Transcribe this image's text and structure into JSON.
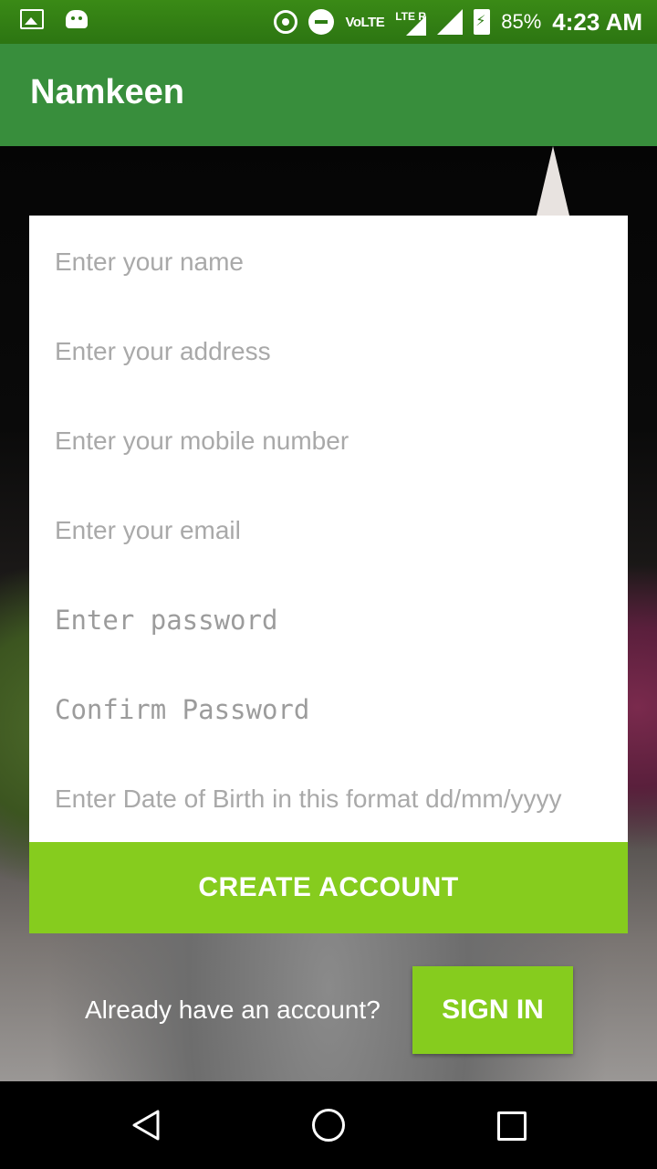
{
  "status_bar": {
    "volte": "VoLTE",
    "lte": "LTE R",
    "battery": "85%",
    "time": "4:23 AM",
    "icons": [
      "image-icon",
      "android-icon",
      "hotspot-icon",
      "do-not-disturb-icon",
      "signal-icon",
      "battery-charging-icon"
    ]
  },
  "app_bar": {
    "title": "Namkeen"
  },
  "form": {
    "name_placeholder": "Enter your name",
    "address_placeholder": "Enter your address",
    "mobile_placeholder": "Enter your mobile number",
    "email_placeholder": "Enter your email",
    "password_placeholder": "Enter password",
    "confirm_password_placeholder": "Confirm Password",
    "dob_placeholder": "Enter Date of Birth in this format dd/mm/yyyy",
    "create_account_label": "CREATE ACCOUNT"
  },
  "footer": {
    "already_text": "Already have an account?",
    "sign_in_label": "SIGN IN"
  },
  "colors": {
    "status_bar": "#2e7d14",
    "app_bar": "#388e3c",
    "accent_button": "#86cc1e"
  },
  "nav_bar": {
    "icons": [
      "back-icon",
      "home-icon",
      "recent-apps-icon"
    ]
  }
}
